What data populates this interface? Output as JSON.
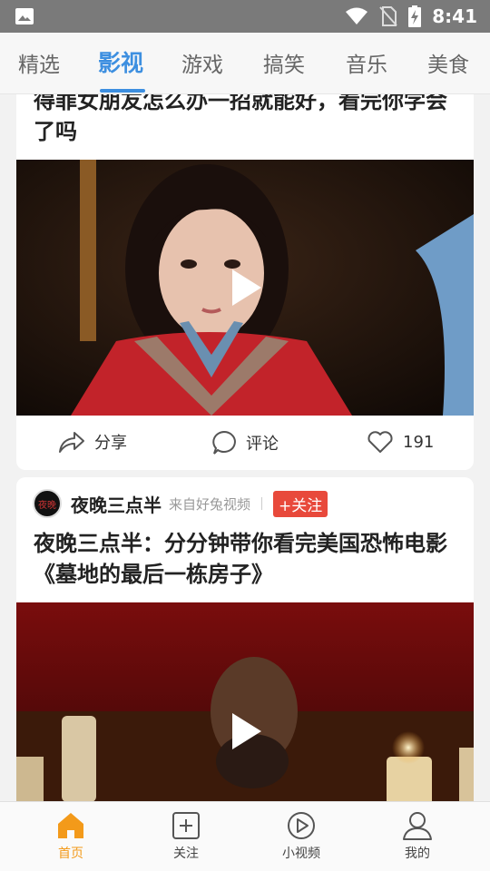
{
  "status_bar": {
    "time": "8:41"
  },
  "tabs": [
    {
      "label": "精选"
    },
    {
      "label": "影视"
    },
    {
      "label": "游戏"
    },
    {
      "label": "搞笑"
    },
    {
      "label": "音乐"
    },
    {
      "label": "美食"
    }
  ],
  "active_tab_index": 1,
  "feed": {
    "card1": {
      "title": "得罪女朋友怎么办一招就能好，看完你学会了吗",
      "actions": {
        "share": "分享",
        "comment": "评论",
        "likes": "191"
      }
    },
    "card2": {
      "author": "夜晚三点半",
      "avatar_text": "夜晚",
      "source": "来自好兔视频",
      "follow_label": "+关注",
      "title": "夜晚三点半：分分钟带你看完美国恐怖电影《墓地的最后一栋房子》"
    }
  },
  "bottom_nav": [
    {
      "label": "首页",
      "icon": "home-icon",
      "active": true
    },
    {
      "label": "关注",
      "icon": "plus-square-icon"
    },
    {
      "label": "小视频",
      "icon": "play-circle-icon"
    },
    {
      "label": "我的",
      "icon": "user-icon"
    }
  ],
  "colors": {
    "accent": "#3d8fe0",
    "follow": "#e8493b",
    "nav_active": "#f39a1a"
  }
}
